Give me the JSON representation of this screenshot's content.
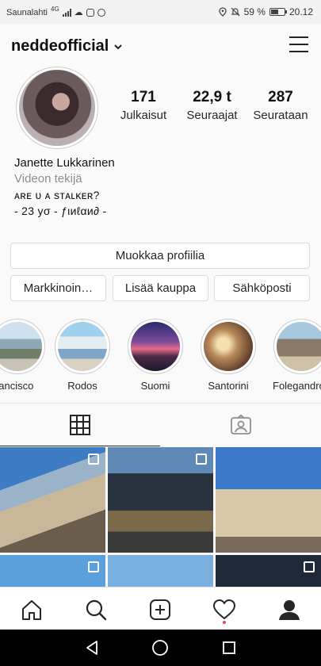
{
  "status_bar": {
    "carrier": "Saunalahti",
    "network": "4G",
    "battery": "59 %",
    "battery_level": 0.59,
    "time": "20.12"
  },
  "header": {
    "username": "neddeofficial"
  },
  "profile": {
    "stats": [
      {
        "value": "171",
        "label": "Julkaisut"
      },
      {
        "value": "22,9 t",
        "label": "Seuraajat"
      },
      {
        "value": "287",
        "label": "Seurataan"
      }
    ],
    "name": "Janette Lukkarinen",
    "category": "Videon tekijä",
    "bio_line1": "ᴀʀᴇ ᴜ ᴀ sᴛᴀʟᴋᴇʀ?",
    "bio_line2": "- 23 уσ - ƒιиℓαи∂ -"
  },
  "buttons": {
    "edit_profile": "Muokkaa profiilia",
    "marketing": "Markkinoin…",
    "add_shop": "Lisää kauppa",
    "email": "Sähköposti"
  },
  "highlights": [
    {
      "label": "Francisco"
    },
    {
      "label": "Rodos"
    },
    {
      "label": "Suomi"
    },
    {
      "label": "Santorini"
    },
    {
      "label": "Folegandros"
    }
  ],
  "tabs": [
    {
      "icon": "grid-icon",
      "active": true
    },
    {
      "icon": "tagged-icon",
      "active": false
    }
  ],
  "nav": [
    "home-icon",
    "search-icon",
    "add-post-icon",
    "activity-heart-icon",
    "profile-icon"
  ],
  "colors": {
    "accent_red": "#ed4956",
    "border": "#dbdbdb",
    "muted_text": "#8e8e8e"
  }
}
